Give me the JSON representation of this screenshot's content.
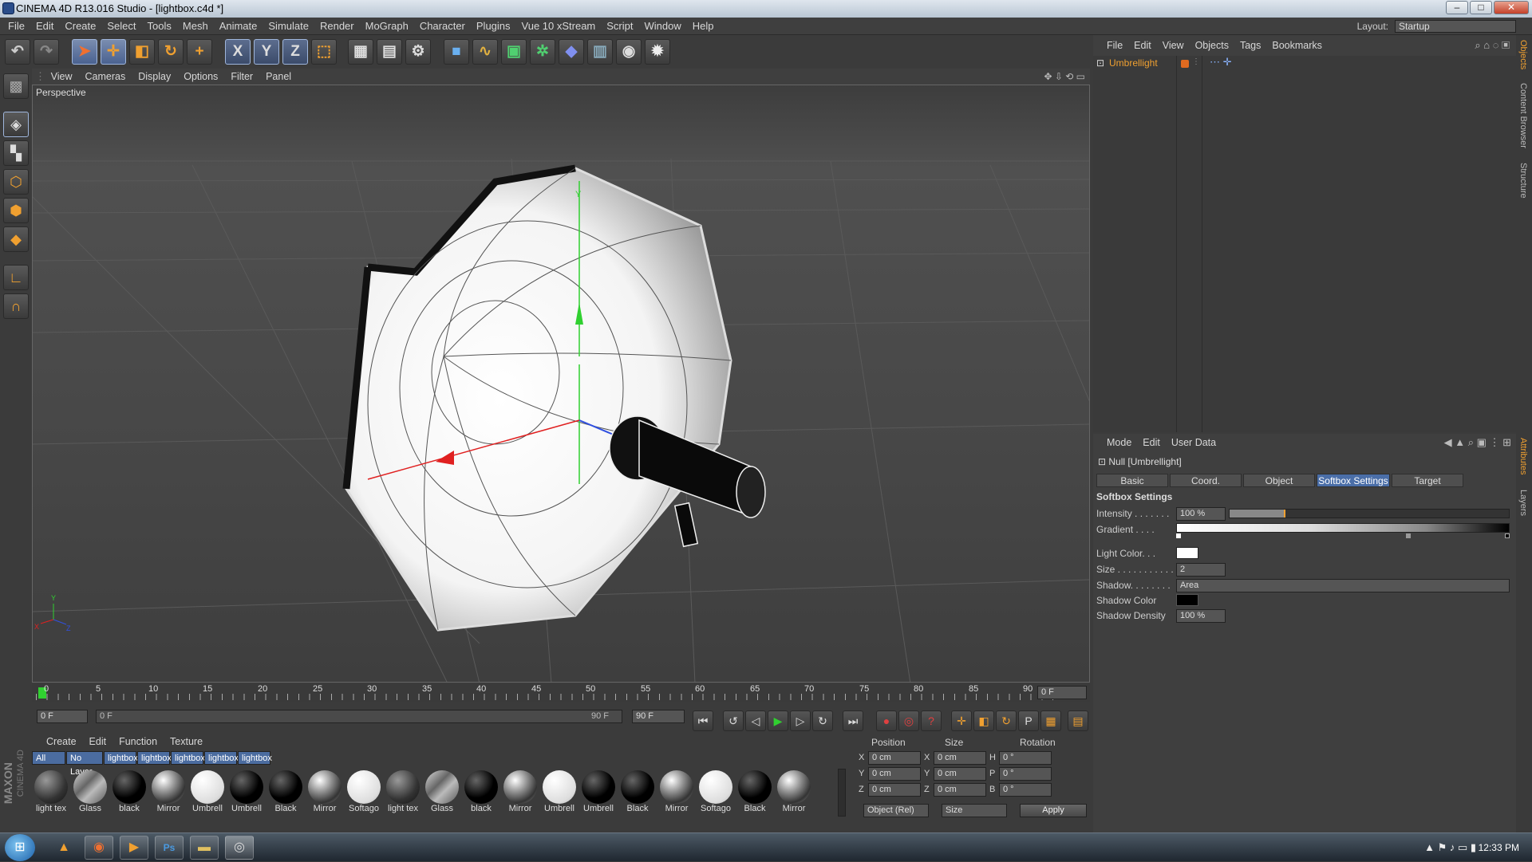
{
  "window": {
    "title": "CINEMA 4D R13.016 Studio - [lightbox.c4d *]",
    "minimize_label": "–",
    "maximize_label": "□",
    "close_label": "✕"
  },
  "menubar": {
    "items": [
      "File",
      "Edit",
      "Create",
      "Select",
      "Tools",
      "Mesh",
      "Animate",
      "Simulate",
      "Render",
      "MoGraph",
      "Character",
      "Plugins",
      "Vue 10 xStream",
      "Script",
      "Window",
      "Help"
    ],
    "layout_label": "Layout:",
    "layout_value": "Startup"
  },
  "toolbar": {
    "axis_x": "X",
    "axis_y": "Y",
    "axis_z": "Z",
    "icons": [
      "undo-icon",
      "redo-icon",
      "select-icon",
      "move-icon",
      "scale-icon",
      "rotate-icon",
      "add-object-icon",
      "x-axis-icon",
      "y-axis-icon",
      "z-axis-icon",
      "coordinate-system-icon",
      "render-view-icon",
      "render-picture-viewer-icon",
      "render-settings-icon",
      "cube-icon",
      "spline-icon",
      "nurbs-icon",
      "array-icon",
      "deformer-icon",
      "scene-icon",
      "camera-icon",
      "light-icon"
    ]
  },
  "viewport": {
    "menu": [
      "View",
      "Cameras",
      "Display",
      "Options",
      "Filter",
      "Panel"
    ],
    "label": "Perspective",
    "axis_y": "Y",
    "axis_x": "X",
    "axis_z": "Z"
  },
  "timeline": {
    "ticks": [
      "0",
      "5",
      "10",
      "15",
      "20",
      "25",
      "30",
      "35",
      "40",
      "45",
      "50",
      "55",
      "60",
      "65",
      "70",
      "75",
      "80",
      "85",
      "90"
    ],
    "frame_display": "0 F"
  },
  "playback": {
    "start_frame": "0 F",
    "range_start": "0 F",
    "range_end": "90 F",
    "end_frame": "90 F"
  },
  "materials": {
    "menu": [
      "Create",
      "Edit",
      "Function",
      "Texture"
    ],
    "tabs": [
      "All",
      "No Layer",
      "lightbox",
      "lightbox",
      "lightbox",
      "lightbox",
      "lightbox"
    ],
    "items": [
      {
        "name": "light tex",
        "style": "dark-grey"
      },
      {
        "name": "Glass",
        "style": "glass"
      },
      {
        "name": "black",
        "style": "black"
      },
      {
        "name": "Mirror",
        "style": "mirror"
      },
      {
        "name": "Umbrell",
        "style": "white"
      },
      {
        "name": "Umbrell",
        "style": "black"
      },
      {
        "name": "Black",
        "style": "black"
      },
      {
        "name": "Mirror",
        "style": "mirror"
      },
      {
        "name": "Softago",
        "style": "white"
      },
      {
        "name": "light tex",
        "style": "dark-grey"
      },
      {
        "name": "Glass",
        "style": "glass"
      },
      {
        "name": "black",
        "style": "black"
      },
      {
        "name": "Mirror",
        "style": "mirror"
      },
      {
        "name": "Umbrell",
        "style": "white"
      },
      {
        "name": "Umbrell",
        "style": "black"
      },
      {
        "name": "Black",
        "style": "black"
      },
      {
        "name": "Mirror",
        "style": "mirror"
      },
      {
        "name": "Softago",
        "style": "white"
      },
      {
        "name": "Black",
        "style": "black"
      },
      {
        "name": "Mirror",
        "style": "mirror"
      }
    ]
  },
  "coords": {
    "headers": [
      "Position",
      "Size",
      "Rotation"
    ],
    "rows": [
      {
        "axis": "X",
        "pos": "0 cm",
        "size_axis": "X",
        "size": "0 cm",
        "rot_axis": "H",
        "rot": "0 °"
      },
      {
        "axis": "Y",
        "pos": "0 cm",
        "size_axis": "Y",
        "size": "0 cm",
        "rot_axis": "P",
        "rot": "0 °"
      },
      {
        "axis": "Z",
        "pos": "0 cm",
        "size_axis": "Z",
        "size": "0 cm",
        "rot_axis": "B",
        "rot": "0 °"
      }
    ],
    "mode_select": "Object (Rel)",
    "size_select": "Size",
    "apply_label": "Apply"
  },
  "object_manager": {
    "menu": [
      "File",
      "Edit",
      "View",
      "Objects",
      "Tags",
      "Bookmarks"
    ],
    "object_name": "Umbrellight"
  },
  "attributes": {
    "menu": [
      "Mode",
      "Edit",
      "User Data"
    ],
    "object_title": "Null [Umbrellight]",
    "tabs": [
      "Basic",
      "Coord.",
      "Object",
      "Softbox Settings",
      "Target"
    ],
    "active_tab": "Softbox Settings",
    "section_title": "Softbox Settings",
    "rows": {
      "intensity_label": "Intensity . . . . . . .",
      "intensity_value": "100 %",
      "gradient_label": "Gradient . . . .",
      "light_color_label": "Light  Color. . .",
      "size_label": "Size . . . . . . . . . . .",
      "size_value": "2",
      "shadow_label": "Shadow. . . . . . . .",
      "shadow_value": "Area",
      "shadow_color_label": "Shadow Color",
      "shadow_density_label": "Shadow Density",
      "shadow_density_value": "100 %"
    },
    "intensity_fill": 0.2
  },
  "side_tabs": {
    "objects": "Objects",
    "content_browser": "Content Browser",
    "structure": "Structure",
    "attributes": "Attributes",
    "layers": "Layers"
  },
  "brand": {
    "maxon": "MAXON",
    "cinema": "CINEMA 4D"
  },
  "taskbar": {
    "clock": "12:33 PM"
  },
  "colors": {
    "accent_orange": "#f0a030",
    "tab_active": "#4a6ea8",
    "axis_red": "#e02020",
    "axis_green": "#30d030",
    "axis_blue": "#3050e0"
  }
}
